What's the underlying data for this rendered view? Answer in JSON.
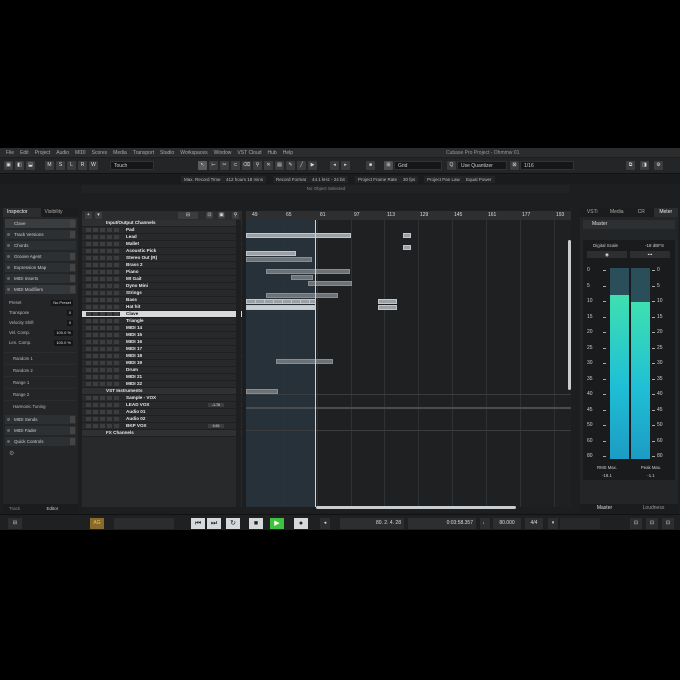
{
  "menu": {
    "items": [
      "File",
      "Edit",
      "Project",
      "Audio",
      "MIDI",
      "Scores",
      "Media",
      "Transport",
      "Studio",
      "Workspaces",
      "Window",
      "VST Cloud",
      "Hub",
      "Help"
    ],
    "window_title": "Cubase Pro Project - Ohmmw 01"
  },
  "toolbar": {
    "touch_mode": "Touch",
    "snap_type": "Grid",
    "quantize_mode": "Use Quantizer",
    "quantize_value": "1/16"
  },
  "status": {
    "max_record_time_label": "Max. Record Time",
    "max_record_time": "412 hours 18 mins",
    "record_format_label": "Record Format",
    "record_format": "44.1 kHz - 24 bit",
    "frame_rate_label": "Project Frame Rate",
    "frame_rate": "30 fps",
    "pan_law_label": "Project Pan Law",
    "pan_law": "Equal Power"
  },
  "info_line": "No Object Selected",
  "inspector": {
    "tabs": [
      "Inspector",
      "Visibility"
    ],
    "track_name": "Clave",
    "sections": [
      "Track Versions",
      "Chords",
      "Groove Agent",
      "Expression Map",
      "MIDI Inserts",
      "MIDI Modifiers"
    ],
    "modifiers": [
      {
        "label": "Preset",
        "value": "No Preset"
      },
      {
        "label": "Transpose",
        "value": "0"
      },
      {
        "label": "Velocity Shift",
        "value": "0"
      },
      {
        "label": "Vel. Comp.",
        "value": "100.0 %"
      },
      {
        "label": "Len. Comp.",
        "value": "100.0 %"
      }
    ],
    "randoms": [
      "Random 1",
      "Random 2",
      "Range 1",
      "Range 2",
      "Harmonic Tuning"
    ],
    "lower_sections": [
      "MIDI Sends",
      "MIDI Fader",
      "Quick Controls"
    ],
    "bottom_tabs": [
      "Track",
      "Editor"
    ]
  },
  "ruler": [
    "49",
    "65",
    "81",
    "97",
    "113",
    "129",
    "145",
    "161",
    "177",
    "193"
  ],
  "tracks": [
    {
      "name": "Input/Output Channels",
      "type": "folder"
    },
    {
      "name": "Pad"
    },
    {
      "name": "Lead"
    },
    {
      "name": "Mallet"
    },
    {
      "name": "Acoustic Pick"
    },
    {
      "name": "Stereo Out (R)"
    },
    {
      "name": "Brass 2"
    },
    {
      "name": "Piano"
    },
    {
      "name": "Mt Gait"
    },
    {
      "name": "Dyno Mini"
    },
    {
      "name": "Strings"
    },
    {
      "name": "Bass"
    },
    {
      "name": "Hat hit"
    },
    {
      "name": "Clave",
      "selected": true
    },
    {
      "name": "Triangle"
    },
    {
      "name": "MIDI 14"
    },
    {
      "name": "MIDI 15"
    },
    {
      "name": "MIDI 16"
    },
    {
      "name": "MIDI 17"
    },
    {
      "name": "MIDI 18"
    },
    {
      "name": "MIDI 19"
    },
    {
      "name": "Drum"
    },
    {
      "name": "MIDI 21"
    },
    {
      "name": "MIDI 22"
    },
    {
      "name": "VST Instruments",
      "type": "folder"
    },
    {
      "name": "Sample - VOX"
    },
    {
      "name": "LEAD VOX",
      "tag": "-1.78"
    },
    {
      "name": "Audio 01"
    },
    {
      "name": "Audio 02"
    },
    {
      "name": "BKP VOX",
      "tag": "0.00"
    },
    {
      "name": "FX Channels",
      "type": "folder"
    }
  ],
  "right_zone": {
    "tabs": [
      "VSTi",
      "Media",
      "CR",
      "Meter"
    ],
    "master": "Master",
    "digital_scale": "Digital Scale",
    "dbfs": "-18 dBFS",
    "scale": [
      "0",
      "5",
      "10",
      "15",
      "20",
      "25",
      "30",
      "35",
      "40",
      "45",
      "50",
      "60",
      "80"
    ],
    "levels": {
      "rms": 0.86,
      "peak": 0.82
    },
    "rms_label": "RMS Max.",
    "rms_value": "-18.1",
    "peak_label": "Peak Max.",
    "peak_value": "-1.1",
    "bottom_tabs": [
      "Master",
      "Loudness"
    ]
  },
  "transport": {
    "ag": "AG",
    "position": "80. 2. 4. 28",
    "time": "0:03:58.357",
    "tempo": "80.000",
    "signature": "4/4"
  },
  "colors": {
    "accent": "#1fc9c0",
    "play_active": "#3fc33f",
    "cursor": "#cfd3d6"
  }
}
